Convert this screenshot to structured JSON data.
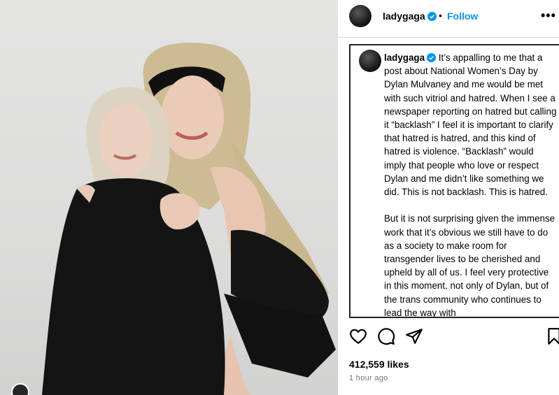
{
  "post": {
    "username": "ladygaga",
    "verified": true,
    "separator": "•",
    "follow_label": "Follow",
    "more_label": "•••",
    "caption_paragraphs": [
      "It’s appalling to me that a post about National Women’s Day by Dylan Mulvaney and me would be met with such vitriol and hatred. When I see a newspaper reporting on hatred but calling it “backlash” I feel it is important to clarify that hatred is hatred, and this kind of hatred is violence. “Backlash” would imply that people who love or respect Dylan and me didn’t like something we did. This is not backlash. This is hatred.",
      "But it is not surprising given the immense work that it’s obvious we still have to do as a society to make room for transgender lives to be cherished and upheld by all of us. I feel very protective in this moment, not only of Dylan, but of the trans community who continues to lead the way with"
    ],
    "likes": "412,559 likes",
    "timestamp": "1 hour ago"
  },
  "icons": {
    "like": "heart-icon",
    "comment": "comment-icon",
    "share": "share-icon",
    "save": "bookmark-icon",
    "verified": "verified-badge-icon",
    "more": "more-options-icon"
  },
  "colors": {
    "follow": "#0095f6",
    "verified": "#0095f6",
    "timestamp": "#737373",
    "divider": "#dbdbdb"
  }
}
